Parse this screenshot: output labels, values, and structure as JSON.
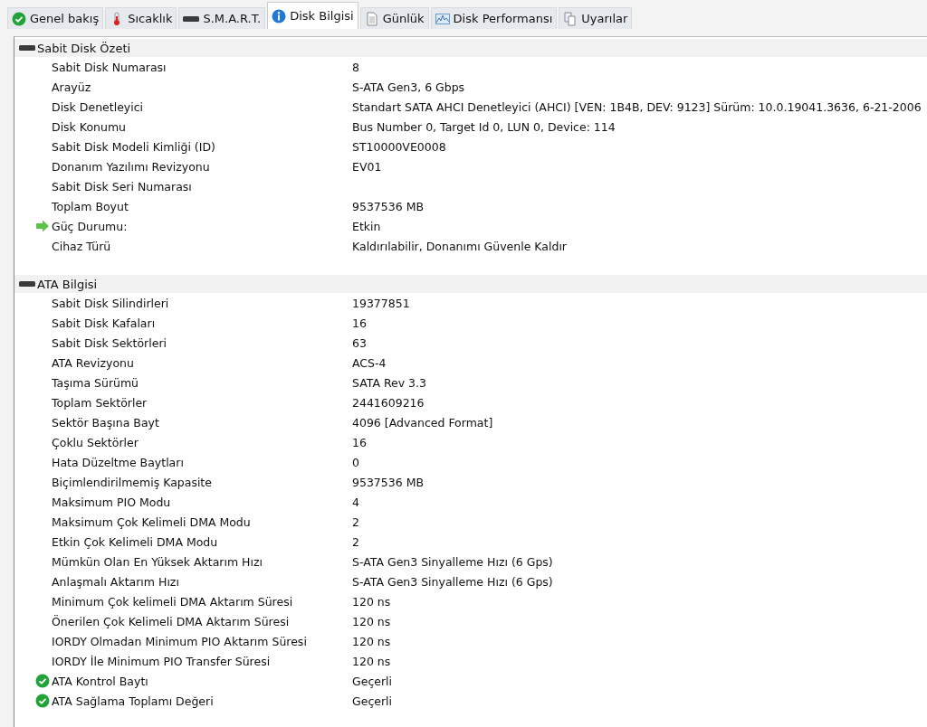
{
  "tabs": [
    {
      "label": "Genel bakış",
      "kind": "check",
      "selected": false
    },
    {
      "label": "Sıcaklık",
      "kind": "thermo",
      "selected": false
    },
    {
      "label": "S.M.A.R.T.",
      "kind": "disk",
      "selected": false
    },
    {
      "label": "Disk Bilgisi",
      "kind": "info",
      "selected": true
    },
    {
      "label": "Günlük",
      "kind": "doc",
      "selected": false
    },
    {
      "label": "Disk Performansı",
      "kind": "chart",
      "selected": false
    },
    {
      "label": "Uyarılar",
      "kind": "docs",
      "selected": false
    }
  ],
  "sections": [
    {
      "title": "Sabit Disk Özeti",
      "rows": [
        {
          "kind": "plain",
          "label": "Sabit Disk Numarası",
          "value": "8"
        },
        {
          "kind": "plain",
          "label": "Arayüz",
          "value": "S-ATA Gen3, 6 Gbps"
        },
        {
          "kind": "plain",
          "label": "Disk Denetleyici",
          "value": "Standart SATA AHCI Denetleyici (AHCI) [VEN: 1B4B, DEV: 9123] Sürüm: 10.0.19041.3636, 6-21-2006"
        },
        {
          "kind": "plain",
          "label": "Disk Konumu",
          "value": "Bus Number 0, Target Id 0, LUN 0, Device: 114"
        },
        {
          "kind": "plain",
          "label": "Sabit Disk Modeli Kimliği (ID)",
          "value": "ST10000VE0008"
        },
        {
          "kind": "plain",
          "label": "Donanım Yazılımı Revizyonu",
          "value": "EV01"
        },
        {
          "kind": "plain",
          "label": "Sabit Disk Seri Numarası"
        },
        {
          "kind": "plain",
          "label": "Toplam Boyut",
          "value": "9537536 MB"
        },
        {
          "kind": "arrow",
          "label": "Güç Durumu:",
          "value": "Etkin"
        },
        {
          "kind": "plain",
          "label": "Cihaz Türü",
          "value": "Kaldırılabilir, Donanımı Güvenle Kaldır"
        }
      ]
    },
    {
      "title": "ATA Bilgisi",
      "rows": [
        {
          "kind": "plain",
          "label": "Sabit Disk Silindirleri",
          "value": "19377851"
        },
        {
          "kind": "plain",
          "label": "Sabit Disk Kafaları",
          "value": "16"
        },
        {
          "kind": "plain",
          "label": "Sabit Disk Sektörleri",
          "value": "63"
        },
        {
          "kind": "plain",
          "label": "ATA Revizyonu",
          "value": "ACS-4"
        },
        {
          "kind": "plain",
          "label": "Taşıma Sürümü",
          "value": "SATA Rev 3.3"
        },
        {
          "kind": "plain",
          "label": "Toplam Sektörler",
          "value": "2441609216"
        },
        {
          "kind": "plain",
          "label": "Sektör Başına Bayt",
          "value": "4096 [Advanced Format]"
        },
        {
          "kind": "plain",
          "label": "Çoklu Sektörler",
          "value": "16"
        },
        {
          "kind": "plain",
          "label": "Hata Düzeltme Baytları",
          "value": "0"
        },
        {
          "kind": "plain",
          "label": "Biçimlendirilmemiş Kapasite",
          "value": "9537536 MB"
        },
        {
          "kind": "plain",
          "label": "Maksimum PIO Modu",
          "value": "4"
        },
        {
          "kind": "plain",
          "label": "Maksimum Çok Kelimeli DMA Modu",
          "value": "2"
        },
        {
          "kind": "plain",
          "label": "Etkin Çok Kelimeli DMA Modu",
          "value": "2"
        },
        {
          "kind": "plain",
          "label": "Mümkün Olan En Yüksek Aktarım Hızı",
          "value": "S-ATA Gen3 Sinyalleme Hızı (6 Gps)"
        },
        {
          "kind": "plain",
          "label": "Anlaşmalı Aktarım Hızı",
          "value": "S-ATA Gen3 Sinyalleme Hızı (6 Gps)"
        },
        {
          "kind": "plain",
          "label": "Minimum Çok kelimeli DMA Aktarım Süresi",
          "value": "120 ns"
        },
        {
          "kind": "plain",
          "label": "Önerilen Çok Kelimeli DMA Aktarım Süresi",
          "value": "120 ns"
        },
        {
          "kind": "plain",
          "label": "IORDY Olmadan Minimum PIO Aktarım Süresi",
          "value": "120 ns"
        },
        {
          "kind": "plain",
          "label": "IORDY İle Minimum PIO Transfer Süresi",
          "value": "120 ns"
        },
        {
          "kind": "check",
          "label": "ATA Kontrol Baytı",
          "value": "Geçerli"
        },
        {
          "kind": "check",
          "label": "ATA Sağlama Toplamı Değeri",
          "value": "Geçerli"
        }
      ]
    }
  ]
}
